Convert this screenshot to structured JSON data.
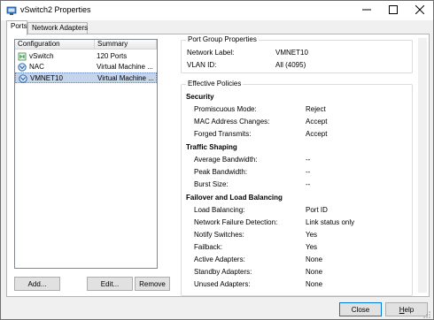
{
  "window": {
    "title": "vSwitch2 Properties",
    "icons": {
      "app": "vswitch-properties-icon",
      "minimize": "minimize-icon",
      "maximize": "maximize-icon",
      "close": "close-icon"
    }
  },
  "tabs": [
    {
      "label": "Ports",
      "active": true
    },
    {
      "label": "Network Adapters",
      "active": false
    }
  ],
  "ports_list": {
    "columns": [
      "Configuration",
      "Summary"
    ],
    "rows": [
      {
        "config": "vSwitch",
        "summary": "120 Ports",
        "icon": "vswitch-icon",
        "selected": false
      },
      {
        "config": "NAC",
        "summary": "Virtual Machine ...",
        "icon": "vm-network-icon",
        "selected": false
      },
      {
        "config": "VMNET10",
        "summary": "Virtual Machine ...",
        "icon": "vm-network-icon",
        "selected": true
      }
    ]
  },
  "list_buttons": {
    "add": "Add...",
    "edit": "Edit...",
    "remove": "Remove"
  },
  "port_group": {
    "title": "Port Group Properties",
    "network_label_key": "Network Label:",
    "network_label_value": "VMNET10",
    "vlan_key": "VLAN ID:",
    "vlan_value": "All (4095)"
  },
  "policies": {
    "title": "Effective Policies",
    "security": {
      "heading": "Security",
      "items": [
        {
          "key": "Promiscuous Mode:",
          "value": "Reject"
        },
        {
          "key": "MAC Address Changes:",
          "value": "Accept"
        },
        {
          "key": "Forged Transmits:",
          "value": "Accept"
        }
      ]
    },
    "shaping": {
      "heading": "Traffic Shaping",
      "items": [
        {
          "key": "Average Bandwidth:",
          "value": "--"
        },
        {
          "key": "Peak Bandwidth:",
          "value": "--"
        },
        {
          "key": "Burst Size:",
          "value": "--"
        }
      ]
    },
    "failover": {
      "heading": "Failover and Load Balancing",
      "items": [
        {
          "key": "Load Balancing:",
          "value": "Port ID"
        },
        {
          "key": "Network Failure Detection:",
          "value": "Link status only"
        },
        {
          "key": "Notify Switches:",
          "value": "Yes"
        },
        {
          "key": "Failback:",
          "value": "Yes"
        },
        {
          "key": "Active Adapters:",
          "value": "None"
        },
        {
          "key": "Standby Adapters:",
          "value": "None"
        },
        {
          "key": "Unused Adapters:",
          "value": "None"
        }
      ]
    }
  },
  "footer": {
    "close": "Close",
    "help": "Help",
    "help_mnemonic": "H",
    "help_rest": "elp"
  },
  "colors": {
    "selection": "#c4d4ea",
    "accent": "#0078d7",
    "vm_icon_blue": "#1e5aa8",
    "vswitch_green": "#2d8a3e"
  }
}
